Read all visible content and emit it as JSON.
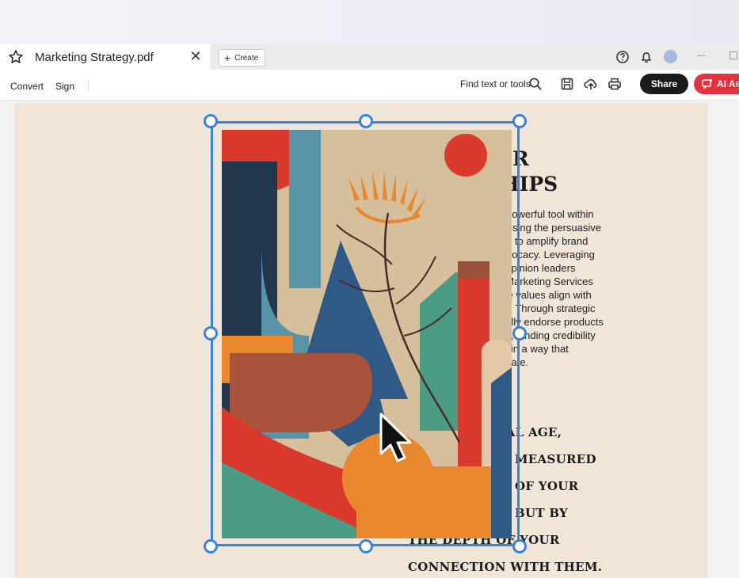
{
  "tab": {
    "title": "Marketing Strategy.pdf",
    "close": "✕",
    "create_label": "Create"
  },
  "toolbar": {
    "convert": "Convert",
    "sign": "Sign",
    "find_label": "Find text or tools",
    "share": "Share",
    "ai_label": "AI As"
  },
  "document": {
    "heading_line1": "ER",
    "heading_line2": "HIPS",
    "body_lines": [
      "e as a powerful tool within",
      ", harnessing the persuasive",
      "uencers to amplify brand",
      "and advocacy. Leveraging",
      "of key opinion leaders",
      "stries, Marketing Services",
      "s whose values align with",
      "present. Through strategic",
      "thentically endorse products",
      "diences, lending credibility",
      "ssages in a way that",
      "ot replicate."
    ],
    "quote_lines": [
      "TAL AGE,",
      "'T MEASURED",
      "OF YOUR",
      "BUT BY",
      "THE DEPTH OF YOUR",
      "CONNECTION WITH THEM."
    ]
  },
  "colors": {
    "accent_blue": "#3b82e0",
    "share_bg": "#1b1b1b",
    "ai_bg": "#e8313d",
    "page_bg": "#efe6d8"
  },
  "icons": {
    "favorite": "star-icon",
    "help": "help-icon",
    "notifications": "bell-icon",
    "search": "search-icon",
    "save": "save-icon",
    "upload": "cloud-upload-icon",
    "print": "print-icon"
  }
}
